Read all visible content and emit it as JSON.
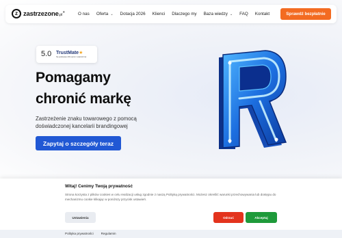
{
  "colors": {
    "accent_orange": "#f36b21",
    "primary_blue": "#2158d4",
    "reject_red": "#e3331d",
    "accept_green": "#1e9a3a"
  },
  "header": {
    "logo_mark": "z",
    "logo_text": "zastrzezone",
    "logo_tld": ".pl",
    "logo_sup": "®",
    "nav": [
      {
        "label": "O nas",
        "dropdown": false
      },
      {
        "label": "Oferta",
        "dropdown": true
      },
      {
        "label": "Dotacja 2026",
        "dropdown": false
      },
      {
        "label": "Klienci",
        "dropdown": false
      },
      {
        "label": "Dlaczego my",
        "dropdown": false
      },
      {
        "label": "Baza wiedzy",
        "dropdown": true
      },
      {
        "label": "FAQ",
        "dropdown": false
      },
      {
        "label": "Kontakt",
        "dropdown": false
      }
    ],
    "dropdown_icon": "chevron-down-icon",
    "cta_label": "Sprawdź bezpłatnie"
  },
  "hero": {
    "trust": {
      "score": "5.0",
      "brand": "TrustMate",
      "subtitle": "Na podstawie 200 opinii z ostatnich lat"
    },
    "title_line1": "Pomagamy",
    "title_line2": "chronić markę",
    "subtitle": "Zastrzeżenie znaku towarowego z pomocą doświadczonej kancelarii brandingowej",
    "button_label": "Zapytaj o szczegóły teraz",
    "art_icon": "neon-letter-r-icon"
  },
  "consent": {
    "title": "Witaj! Cenimy Twoją prywatność",
    "text": "Strona korzysta z plików cookies w celu realizacji usług zgodnie z naszą Polityką prywatności. Możesz określić warunki przechowywania lub dostępu do mechanizmu cookie klikając w poniższy przycisk ustawień.",
    "settings_label": "Ustawienia",
    "reject_label": "Odrzuć",
    "accept_label": "Akceptuj"
  },
  "footer": {
    "links": [
      "Polityka prywatności",
      "Regulamin"
    ]
  }
}
